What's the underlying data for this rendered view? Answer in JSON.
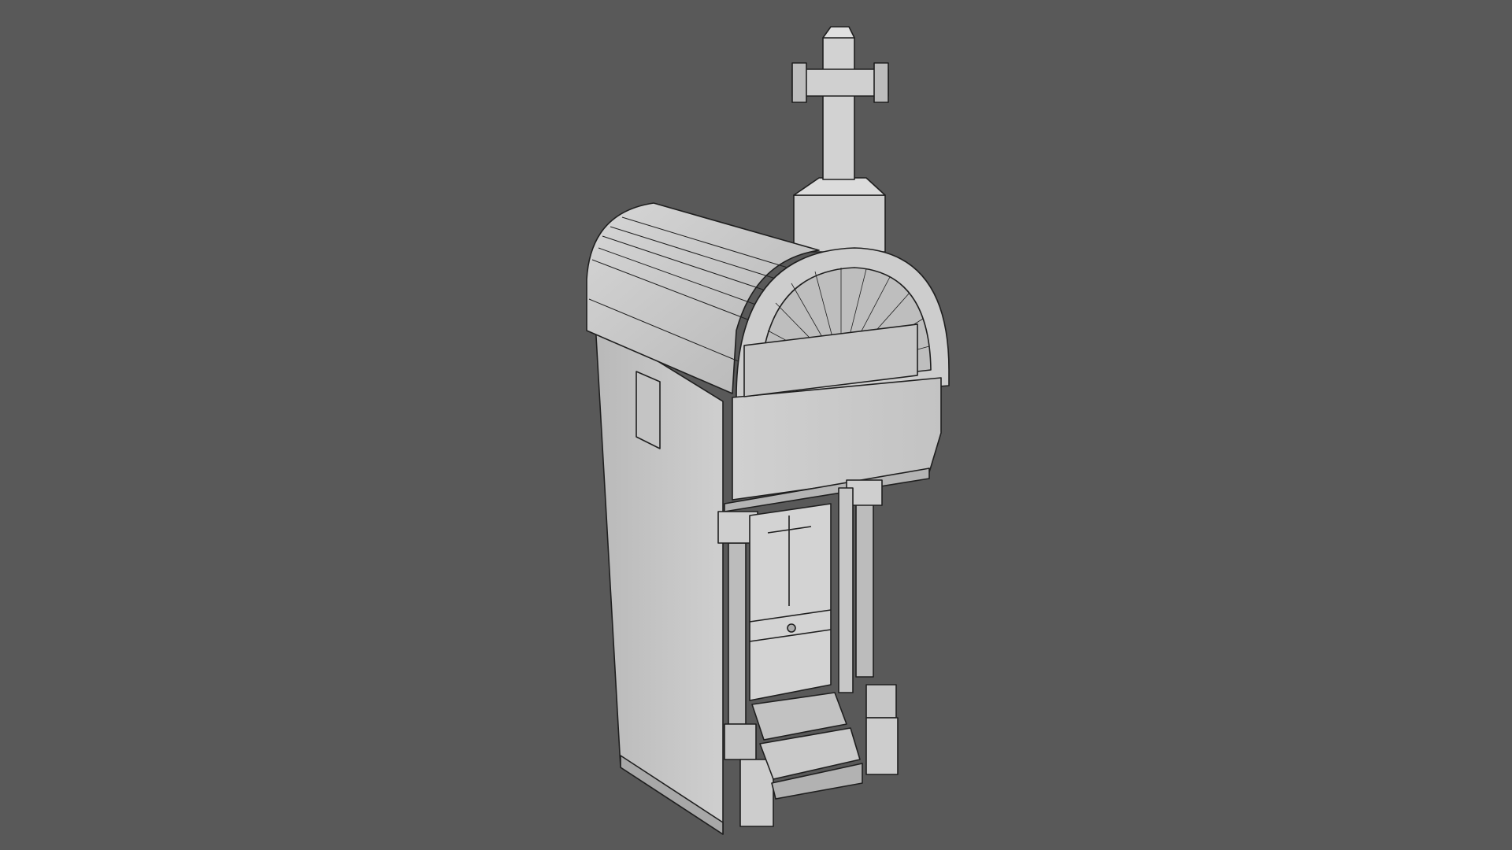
{
  "viewport": {
    "background": "#595959"
  },
  "model": {
    "subject": "mausoleum-wireframe-render",
    "material_color": "#c8c8c8",
    "edge_color": "#1f1f1f"
  }
}
